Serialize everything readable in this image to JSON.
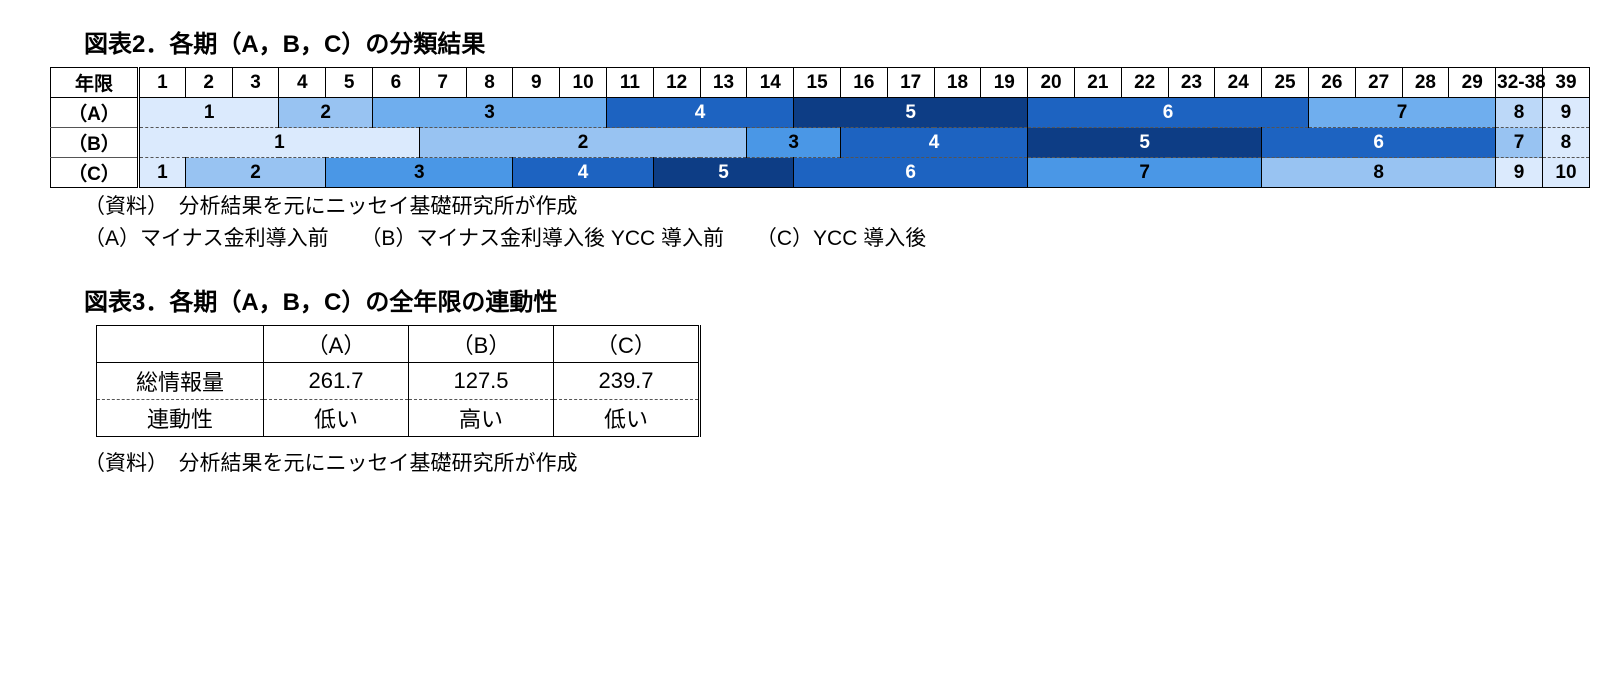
{
  "fig2": {
    "title": "図表2．各期（A，B，C）の分類結果",
    "header_label": "年限",
    "col_labels": [
      "1",
      "2",
      "3",
      "4",
      "5",
      "6",
      "7",
      "8",
      "9",
      "10",
      "11",
      "12",
      "13",
      "14",
      "15",
      "16",
      "17",
      "18",
      "19",
      "20",
      "21",
      "22",
      "23",
      "24",
      "25",
      "26",
      "27",
      "28",
      "29",
      "32-38",
      "39"
    ],
    "row_labels": [
      "（A）",
      "（B）",
      "（C）"
    ],
    "rowA": [
      {
        "v": "1",
        "span": 3,
        "shade": 0
      },
      {
        "v": "2",
        "span": 2,
        "shade": 2
      },
      {
        "v": "3",
        "span": 5,
        "shade": 3
      },
      {
        "v": "4",
        "span": 4,
        "shade": 6
      },
      {
        "v": "5",
        "span": 5,
        "shade": 8
      },
      {
        "v": "6",
        "span": 6,
        "shade": 6
      },
      {
        "v": "7",
        "span": 4,
        "shade": 3
      },
      {
        "v": "8",
        "span": 1,
        "shade": 1
      },
      {
        "v": "9",
        "span": 1,
        "shade": 0
      }
    ],
    "rowB": [
      {
        "v": "1",
        "span": 6,
        "shade": 0
      },
      {
        "v": "2",
        "span": 7,
        "shade": 2
      },
      {
        "v": "3",
        "span": 2,
        "shade": 4
      },
      {
        "v": "4",
        "span": 4,
        "shade": 6
      },
      {
        "v": "5",
        "span": 5,
        "shade": 8
      },
      {
        "v": "6",
        "span": 5,
        "shade": 6
      },
      {
        "v": "7",
        "span": 1,
        "shade": 2
      },
      {
        "v": "8",
        "span": 1,
        "shade": 0
      }
    ],
    "rowC": [
      {
        "v": "1",
        "span": 1,
        "shade": 0
      },
      {
        "v": "2",
        "span": 3,
        "shade": 2
      },
      {
        "v": "3",
        "span": 4,
        "shade": 4
      },
      {
        "v": "4",
        "span": 3,
        "shade": 6
      },
      {
        "v": "5",
        "span": 3,
        "shade": 8
      },
      {
        "v": "6",
        "span": 5,
        "shade": 6
      },
      {
        "v": "7",
        "span": 5,
        "shade": 4
      },
      {
        "v": "8",
        "span": 5,
        "shade": 2
      },
      {
        "v": "9",
        "span": 1,
        "shade": 0
      },
      {
        "v": "10",
        "span": 1,
        "shade": 0
      }
    ],
    "note1": "（資料）　分析結果を元にニッセイ基礎研究所が作成",
    "note2a": "（A）マイナス金利導入前",
    "note2b": "（B）マイナス金利導入後 YCC 導入前",
    "note2c": "（C）YCC 導入後"
  },
  "fig3": {
    "title": "図表3．各期（A，B，C）の全年限の連動性",
    "cols": [
      "（A）",
      "（B）",
      "（C）"
    ],
    "rows": {
      "info_label": "総情報量",
      "info_vals": [
        "261.7",
        "127.5",
        "239.7"
      ],
      "link_label": "連動性",
      "link_vals": [
        "低い",
        "高い",
        "低い"
      ]
    },
    "note": "（資料）　分析結果を元にニッセイ基礎研究所が作成"
  },
  "chart_data": {
    "type": "table",
    "title": "図表3．各期（A，B，C）の全年限の連動性",
    "columns": [
      "(A)",
      "(B)",
      "(C)"
    ],
    "rows": [
      {
        "label": "総情報量",
        "values": [
          261.7,
          127.5,
          239.7
        ]
      },
      {
        "label": "連動性",
        "values": [
          "低い",
          "高い",
          "低い"
        ]
      }
    ]
  }
}
